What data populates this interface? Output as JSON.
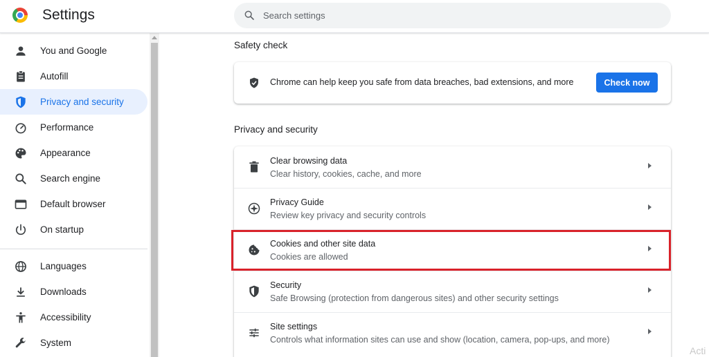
{
  "header": {
    "title": "Settings",
    "search_placeholder": "Search settings"
  },
  "sidebar": {
    "items": [
      {
        "label": "You and Google",
        "icon": "person-icon"
      },
      {
        "label": "Autofill",
        "icon": "clipboard-icon"
      },
      {
        "label": "Privacy and security",
        "icon": "shield-icon",
        "active": true
      },
      {
        "label": "Performance",
        "icon": "speedometer-icon"
      },
      {
        "label": "Appearance",
        "icon": "palette-icon"
      },
      {
        "label": "Search engine",
        "icon": "search-icon"
      },
      {
        "label": "Default browser",
        "icon": "browser-icon"
      },
      {
        "label": "On startup",
        "icon": "power-icon"
      },
      {
        "label": "Languages",
        "icon": "globe-icon"
      },
      {
        "label": "Downloads",
        "icon": "download-icon"
      },
      {
        "label": "Accessibility",
        "icon": "accessibility-icon"
      },
      {
        "label": "System",
        "icon": "wrench-icon"
      }
    ]
  },
  "safety_check": {
    "title": "Safety check",
    "text": "Chrome can help keep you safe from data breaches, bad extensions, and more",
    "button": "Check now"
  },
  "privacy": {
    "title": "Privacy and security",
    "rows": [
      {
        "title": "Clear browsing data",
        "subtitle": "Clear history, cookies, cache, and more",
        "icon": "trash-icon"
      },
      {
        "title": "Privacy Guide",
        "subtitle": "Review key privacy and security controls",
        "icon": "compass-icon"
      },
      {
        "title": "Cookies and other site data",
        "subtitle": "Cookies are allowed",
        "icon": "cookie-icon",
        "highlighted": true
      },
      {
        "title": "Security",
        "subtitle": "Safe Browsing (protection from dangerous sites) and other security settings",
        "icon": "shield-icon"
      },
      {
        "title": "Site settings",
        "subtitle": "Controls what information sites can use and show (location, camera, pop-ups, and more)",
        "icon": "sliders-icon"
      }
    ]
  },
  "watermark": "Acti",
  "colors": {
    "accent": "#1a73e8",
    "active_bg": "#e8f0fe",
    "highlight": "#d9222a"
  }
}
